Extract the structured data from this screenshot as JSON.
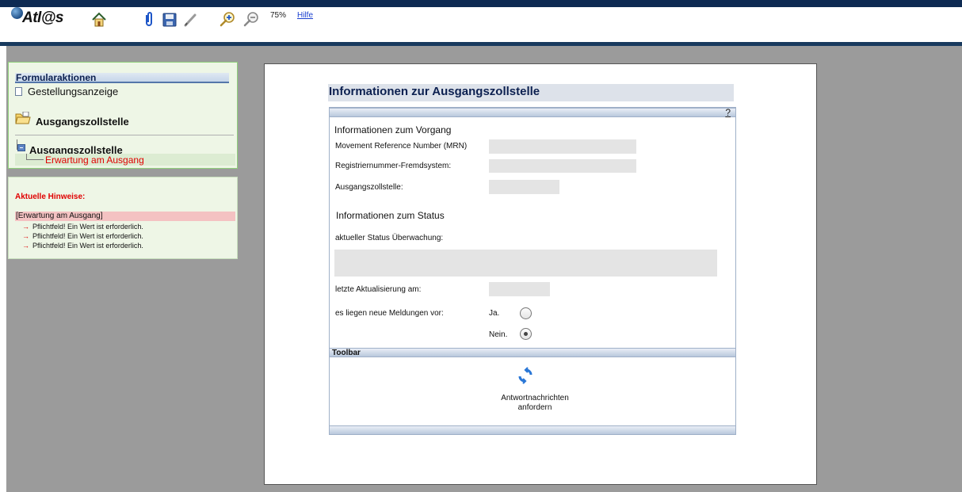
{
  "app": {
    "logo_text": "Atl@s",
    "zoom_level": "75%",
    "help_link": "Hilfe"
  },
  "icons": {
    "home": "home-icon",
    "attachment": "paperclip-icon",
    "save": "floppy-disk-icon",
    "edit": "pencil-icon",
    "zoom_in": "zoom-in-icon",
    "zoom_out": "zoom-out-icon"
  },
  "actions_panel": {
    "header": "Formularaktionen",
    "items": [
      {
        "label": "Gestellungsanzeige"
      }
    ],
    "folder_label": "Ausgangszollstelle",
    "tree": {
      "node_label": "Ausgangszollstelle",
      "child_label": "Erwartung am Ausgang"
    }
  },
  "notes_panel": {
    "title": "Aktuelle Hinweise:",
    "section": "[Erwartung am Ausgang]",
    "messages": [
      "Pflichtfeld! Ein Wert ist erforderlich.",
      "Pflichtfeld! Ein Wert ist erforderlich.",
      "Pflichtfeld! Ein Wert ist erforderlich."
    ]
  },
  "document": {
    "title": "Informationen zur Ausgangszollstelle",
    "help_marker": "?",
    "section_vorgang": "Informationen zum Vorgang",
    "fields": {
      "mrn": {
        "label": "Movement Reference Number (MRN)",
        "value": ""
      },
      "reg_nr": {
        "label": "Registriernummer-Fremdsystem:",
        "value": ""
      },
      "office": {
        "label": "Ausgangszollstelle:",
        "value": ""
      }
    },
    "section_status": "Informationen zum Status",
    "status_label": "aktueller Status Überwachung:",
    "status_value": "",
    "last_update": {
      "label": "letzte Aktualisierung am:",
      "value": ""
    },
    "new_messages": {
      "label": "es liegen neue Meldungen vor:",
      "options": [
        "Ja.",
        "Nein."
      ],
      "selected": "Nein."
    },
    "toolbar_label": "Toolbar",
    "action_button": "Antwortnachrichten anfordern"
  },
  "colors": {
    "topbar": "#0e2a52",
    "workspace": "#9b9b9b",
    "panel_bg": "#eef6e6",
    "error_red": "#e00000",
    "note_highlight": "#f4c2c2",
    "title_bar": "#dde2ea"
  }
}
